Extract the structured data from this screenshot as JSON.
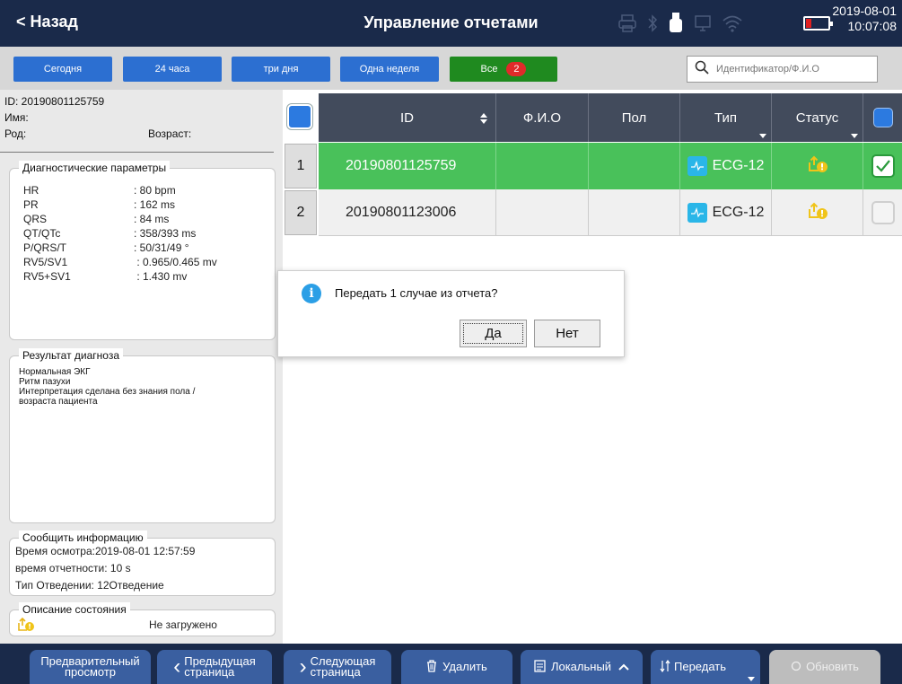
{
  "header": {
    "back_label": "< Назад",
    "title": "Управление отчетами",
    "date": "2019-08-01",
    "time": "10:07:08",
    "status_icons": [
      "printer-icon",
      "bluetooth-icon",
      "usb-icon",
      "network-icon",
      "wifi-icon",
      "battery-icon"
    ]
  },
  "filters": {
    "today": "Сегодня",
    "day": "24 часа",
    "three_days": "три дня",
    "week": "Одна неделя",
    "all": "Все",
    "all_count": "2",
    "search_placeholder": "Идентификатор/Ф.И.О"
  },
  "patient": {
    "id": "ID: 20190801125759",
    "name": "Имя:",
    "gender": "Род:",
    "age": "Возраст:"
  },
  "diagnostics": {
    "legend": "Диагностические параметры",
    "params": [
      {
        "key": "HR",
        "value": ": 80 bpm"
      },
      {
        "key": "PR",
        "value": ": 162 ms"
      },
      {
        "key": "QRS",
        "value": ": 84 ms"
      },
      {
        "key": "QT/QTc",
        "value": ": 358/393 ms"
      },
      {
        "key": "P/QRS/T",
        "value": ": 50/31/49 °"
      },
      {
        "key": "RV5/SV1",
        "value": " : 0.965/0.465 mv"
      },
      {
        "key": "RV5+SV1",
        "value": " : 1.430 mv"
      }
    ]
  },
  "diagnosis": {
    "legend": "Результат диагноза",
    "lines": [
      "Нормальная ЭКГ",
      "Ритм пазухи",
      "Интерпретация сделана без знания пола /",
      "возраста пациента"
    ]
  },
  "report_info": {
    "legend": "Сообщить информацию",
    "exam_time": "Время осмотра:2019-08-01 12:57:59",
    "duration": "время отчетности: 10 s",
    "lead_type": "Тип Отведении: 12Отведение"
  },
  "state": {
    "legend": "Описание состояния",
    "value": "Не загружено"
  },
  "table": {
    "columns": [
      "ID",
      "Ф.И.О",
      "Пол",
      "Тип",
      "Статус"
    ],
    "rows": [
      {
        "num": "1",
        "id": "20190801125759",
        "name": "",
        "gender": "",
        "type": "ECG-12",
        "selected": true
      },
      {
        "num": "2",
        "id": "20190801123006",
        "name": "",
        "gender": "",
        "type": "ECG-12",
        "selected": false
      }
    ]
  },
  "dialog": {
    "message": "Передать 1 случае из отчета?",
    "yes": "Да",
    "no": "Нет"
  },
  "bottom": {
    "preview_1": "Предварительный",
    "preview_2": "просмотр",
    "prev_1": "Предыдущая",
    "prev_2": "страница",
    "next_1": "Следующая",
    "next_2": "страница",
    "delete": "Удалить",
    "local": "Локальный",
    "transfer": "Передать",
    "refresh": "Обновить"
  },
  "colors": {
    "header_bg": "#1a2a4a",
    "filter_btn": "#2c6fd1",
    "all_btn": "#1f8a1f",
    "selected_row": "#49c15a",
    "table_header": "#424b5c",
    "status_icon": "#f0c419"
  }
}
